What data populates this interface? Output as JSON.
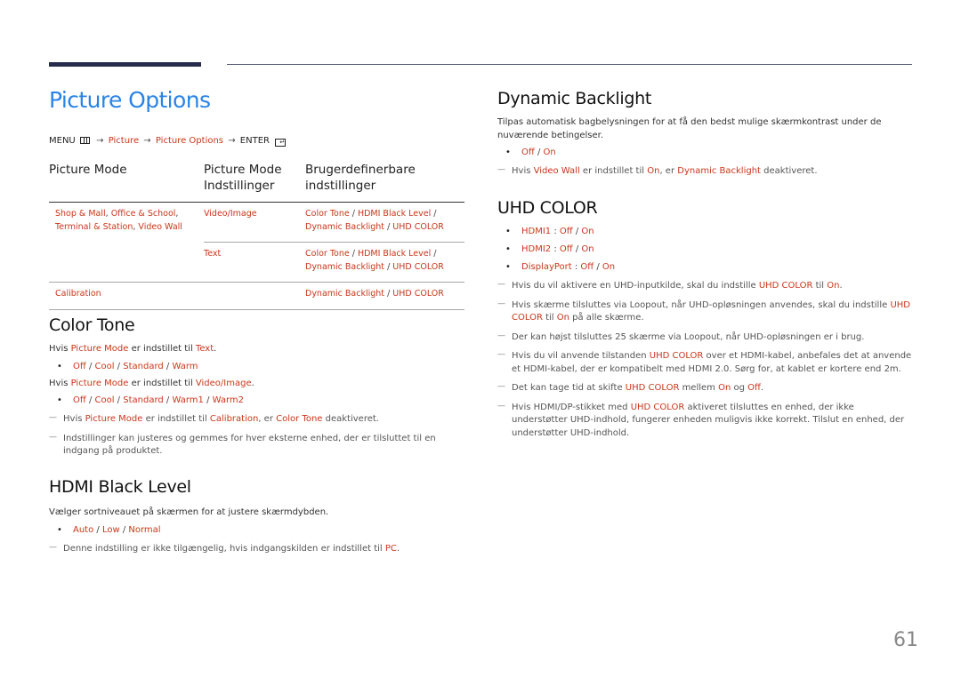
{
  "page": {
    "title": "Picture Options",
    "page_number": "61",
    "accent_color": "#2a84e7",
    "highlight_color": "#c9361b"
  },
  "menu_path": {
    "menu": "MENU",
    "menu_icon": "menu-grid-icon",
    "arrow": "→",
    "step1": "Picture",
    "step2": "Picture Options",
    "enter": "ENTER",
    "enter_icon": "enter-icon",
    "enter_glyph": "↵"
  },
  "mode_table": {
    "headers": [
      "Picture Mode",
      "Picture Mode\nIndstillinger",
      "Brugerdefinerbare\nindstillinger"
    ],
    "header_lines": {
      "h1": "Picture Mode",
      "h2a": "Picture Mode",
      "h2b": "Indstillinger",
      "h3a": "Brugerdefinerbare",
      "h3b": "indstillinger"
    },
    "rows": [
      {
        "mode_l1a": "Shop & Mall",
        "mode_l1b": "Office & School",
        "mode_l2a": "Terminal & Station",
        "mode_l2b": "Video Wall",
        "setting": "Video/Image",
        "custom": [
          "Color Tone",
          "HDMI Black Level",
          "Dynamic Backlight",
          "UHD COLOR"
        ]
      },
      {
        "setting": "Text",
        "custom": [
          "Color Tone",
          "HDMI Black Level",
          "Dynamic Backlight",
          "UHD COLOR"
        ]
      },
      {
        "mode": "Calibration",
        "setting": "",
        "custom": [
          "Dynamic Backlight",
          "UHD COLOR"
        ]
      }
    ]
  },
  "color_tone": {
    "heading": "Color Tone",
    "cond1": {
      "pre": "Hvis ",
      "hl": "Picture Mode",
      "mid": " er indstillet til ",
      "val": "Text",
      "post": "."
    },
    "opts1": [
      "Off",
      "Cool",
      "Standard",
      "Warm"
    ],
    "cond2": {
      "pre": "Hvis ",
      "hl": "Picture Mode",
      "mid": " er indstillet til ",
      "val": "Video/Image",
      "post": "."
    },
    "opts2": [
      "Off",
      "Cool",
      "Standard",
      "Warm1",
      "Warm2"
    ],
    "note1": {
      "pre": "Hvis ",
      "hl1": "Picture Mode",
      "mid": " er indstillet til ",
      "hl2": "Calibration",
      "mid2": ", er ",
      "hl3": "Color Tone",
      "post": " deaktiveret."
    },
    "note2": "Indstillinger kan justeres og gemmes for hver eksterne enhed, der er tilsluttet til en indgang på produktet."
  },
  "hdmi_black_level": {
    "heading": "HDMI Black Level",
    "desc": "Vælger sortniveauet på skærmen for at justere skærmdybden.",
    "opts": [
      "Auto",
      "Low",
      "Normal"
    ],
    "note": {
      "pre": "Denne indstilling er ikke tilgængelig, hvis indgangskilden er indstillet til ",
      "hl": "PC",
      "post": "."
    }
  },
  "dynamic_backlight": {
    "heading": "Dynamic Backlight",
    "desc": "Tilpas automatisk bagbelysningen for at få den bedst mulige skærmkontrast under de nuværende betingelser.",
    "opts": [
      "Off",
      "On"
    ],
    "note": {
      "pre": "Hvis ",
      "hl1": "Video Wall",
      "mid": " er indstillet til ",
      "hl2": "On",
      "mid2": ", er ",
      "hl3": "Dynamic Backlight",
      "post": " deaktiveret."
    }
  },
  "uhd_color": {
    "heading": "UHD COLOR",
    "items": [
      {
        "port": "HDMI1",
        "colon": " : ",
        "off": "Off",
        "on": "On"
      },
      {
        "port": "HDMI2",
        "colon": " : ",
        "off": "Off",
        "on": "On"
      },
      {
        "port": "DisplayPort",
        "colon": " : ",
        "off": "Off",
        "on": "On"
      }
    ],
    "note1": {
      "pre": "Hvis du vil aktivere en UHD-inputkilde, skal du indstille ",
      "hl1": "UHD COLOR",
      "mid": " til ",
      "hl2": "On",
      "post": "."
    },
    "note2": {
      "pre": "Hvis skærme tilsluttes via Loopout, når UHD-opløsningen anvendes, skal du indstille ",
      "hl1": "UHD COLOR",
      "mid": " til ",
      "hl2": "On",
      "post": " på alle skærme."
    },
    "note3": "Der kan højst tilsluttes 25 skærme via Loopout, når UHD-opløsningen er i brug.",
    "note4": {
      "pre": "Hvis du vil anvende tilstanden ",
      "hl1": "UHD COLOR",
      "post": " over et HDMI-kabel, anbefales det at anvende et HDMI-kabel, der er kompatibelt med HDMI 2.0. Sørg for, at kablet er kortere end 2m."
    },
    "note5": {
      "pre": "Det kan tage tid at skifte ",
      "hl1": "UHD COLOR",
      "mid": " mellem ",
      "hl2": "On",
      "mid2": " og ",
      "hl3": "Off",
      "post": "."
    },
    "note6": {
      "pre": "Hvis HDMI/DP-stikket med ",
      "hl1": "UHD COLOR",
      "post": " aktiveret tilsluttes en enhed, der ikke understøtter UHD-indhold, fungerer enheden muligvis ikke korrekt. Tilslut en enhed, der understøtter UHD-indhold."
    }
  },
  "glyphs": {
    "slash": " / ",
    "comma": ", ",
    "bullet": "•",
    "dash": "—"
  }
}
